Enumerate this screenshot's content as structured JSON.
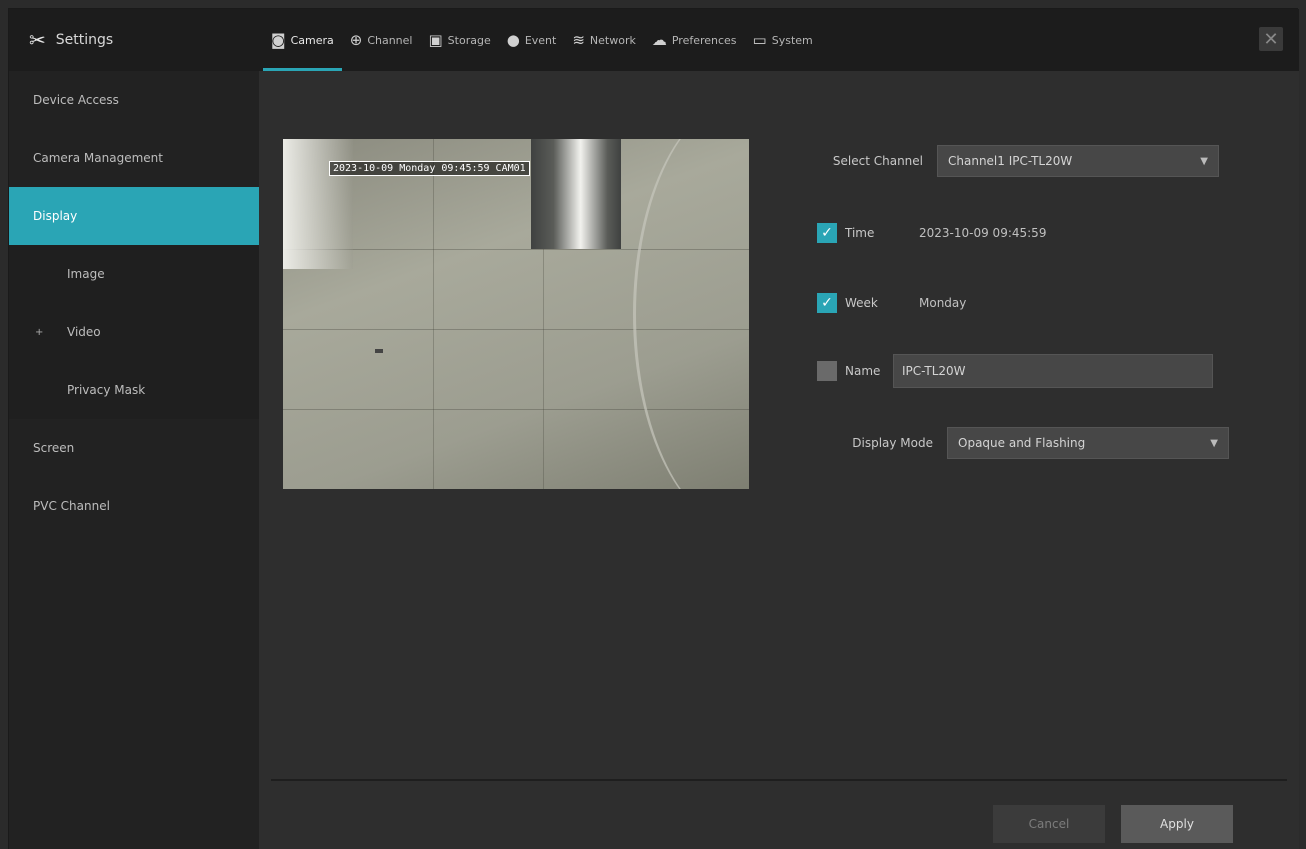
{
  "brand": {
    "title": "Settings",
    "icon": "tools-icon"
  },
  "tabs": [
    {
      "label": "Camera",
      "icon": "camera-icon",
      "active": true
    },
    {
      "label": "Channel",
      "icon": "crosshair-icon",
      "active": false
    },
    {
      "label": "Storage",
      "icon": "disk-icon",
      "active": false
    },
    {
      "label": "Event",
      "icon": "bell-icon",
      "active": false
    },
    {
      "label": "Network",
      "icon": "wifi-icon",
      "active": false
    },
    {
      "label": "Preferences",
      "icon": "cloud-icon",
      "active": false
    },
    {
      "label": "System",
      "icon": "monitor-icon",
      "active": false
    }
  ],
  "sidebar": {
    "items": [
      {
        "label": "Device Access"
      },
      {
        "label": "Camera Management"
      },
      {
        "label": "Display",
        "active": true
      },
      {
        "label": "Image",
        "sub": true
      },
      {
        "label": "Video",
        "sub": true,
        "expander": "+"
      },
      {
        "label": "Privacy Mask",
        "sub": true
      },
      {
        "label": "Screen"
      },
      {
        "label": "PVC Channel"
      }
    ]
  },
  "preview": {
    "osd_text": "2023-10-09 Monday 09:45:59 CAM01"
  },
  "form": {
    "select_channel_label": "Select Channel",
    "select_channel_value": "Channel1 IPC-TL20W",
    "time_label": "Time",
    "time_value": "2023-10-09 09:45:59",
    "time_checked": true,
    "week_label": "Week",
    "week_value": "Monday",
    "week_checked": true,
    "name_label": "Name",
    "name_value": "IPC-TL20W",
    "name_checked": false,
    "display_mode_label": "Display Mode",
    "display_mode_value": "Opaque and Flashing"
  },
  "buttons": {
    "cancel": "Cancel",
    "apply": "Apply"
  },
  "colors": {
    "accent": "#2aa5b5",
    "background": "#2e2e2e",
    "sidebar": "#222222"
  }
}
